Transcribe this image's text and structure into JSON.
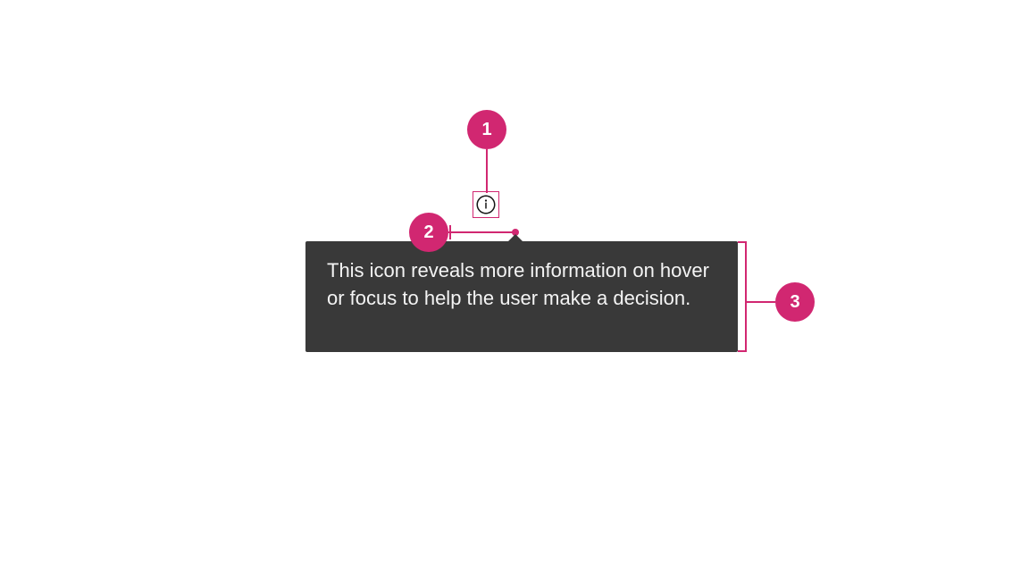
{
  "annotations": {
    "badge1": "1",
    "badge2": "2",
    "badge3": "3"
  },
  "tooltip": {
    "text": "This icon reveals more information on hover or focus to help the user make a decision."
  },
  "colors": {
    "accent": "#d12771",
    "tooltip_bg": "#393939",
    "tooltip_fg": "#f4f4f4"
  }
}
